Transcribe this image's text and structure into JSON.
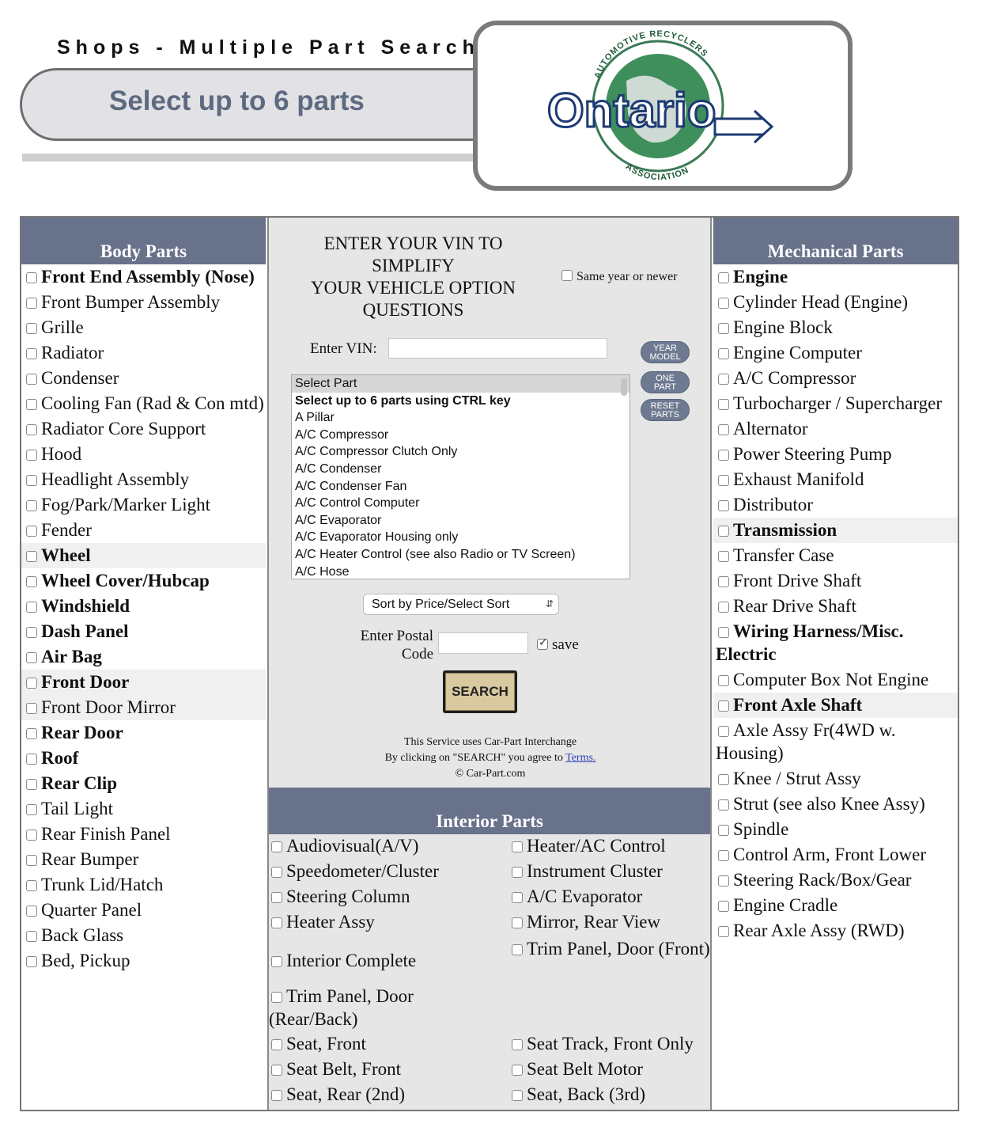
{
  "header": {
    "title": "Shops - Multiple Part Search",
    "banner": "Select up to 6 parts",
    "logo": {
      "top_arc": "AUTOMOTIVE RECYCLERS",
      "word": "Ontario",
      "bottom_arc": "ASSOCIATION"
    }
  },
  "body_parts": {
    "title": "Body Parts",
    "items": [
      {
        "label": "Front End Assembly (Nose)",
        "bold": true
      },
      {
        "label": "Front Bumper Assembly",
        "bold": false
      },
      {
        "label": "Grille",
        "bold": false
      },
      {
        "label": "Radiator",
        "bold": false
      },
      {
        "label": "Condenser",
        "bold": false
      },
      {
        "label": "Cooling Fan (Rad & Con mtd)",
        "bold": false
      },
      {
        "label": "Radiator Core Support",
        "bold": false
      },
      {
        "label": "Hood",
        "bold": false
      },
      {
        "label": "Headlight Assembly",
        "bold": false
      },
      {
        "label": "Fog/Park/Marker Light",
        "bold": false
      },
      {
        "label": "Fender",
        "bold": false
      },
      {
        "label": "Wheel",
        "bold": true
      },
      {
        "label": "Wheel Cover/Hubcap",
        "bold": true
      },
      {
        "label": "Windshield",
        "bold": true
      },
      {
        "label": "Dash Panel",
        "bold": true
      },
      {
        "label": "Air Bag",
        "bold": true
      },
      {
        "label": "Front Door",
        "bold": true
      },
      {
        "label": "Front Door Mirror",
        "bold": false
      },
      {
        "label": "Rear Door",
        "bold": true
      },
      {
        "label": "Roof",
        "bold": true
      },
      {
        "label": "Rear Clip",
        "bold": true
      },
      {
        "label": "Tail Light",
        "bold": false
      },
      {
        "label": "Rear Finish Panel",
        "bold": false
      },
      {
        "label": "Rear Bumper",
        "bold": false
      },
      {
        "label": "Trunk Lid/Hatch",
        "bold": false
      },
      {
        "label": "Quarter Panel",
        "bold": false
      },
      {
        "label": "Back Glass",
        "bold": false
      },
      {
        "label": "Bed, Pickup",
        "bold": false
      }
    ]
  },
  "mechanical_parts": {
    "title": "Mechanical Parts",
    "items": [
      {
        "label": "Engine",
        "bold": true
      },
      {
        "label": "Cylinder Head (Engine)",
        "bold": false
      },
      {
        "label": "Engine Block",
        "bold": false
      },
      {
        "label": "Engine Computer",
        "bold": false
      },
      {
        "label": "A/C Compressor",
        "bold": false
      },
      {
        "label": "Turbocharger / Supercharger",
        "bold": false
      },
      {
        "label": "Alternator",
        "bold": false
      },
      {
        "label": "Power Steering Pump",
        "bold": false
      },
      {
        "label": "Exhaust Manifold",
        "bold": false
      },
      {
        "label": "Distributor",
        "bold": false
      },
      {
        "label": "Transmission",
        "bold": true
      },
      {
        "label": "Transfer Case",
        "bold": false
      },
      {
        "label": "Front Drive Shaft",
        "bold": false
      },
      {
        "label": "Rear Drive Shaft",
        "bold": false
      },
      {
        "label": "Wiring Harness/Misc. Electric",
        "bold": true
      },
      {
        "label": "Computer Box Not Engine",
        "bold": false
      },
      {
        "label": "Front Axle Shaft",
        "bold": true
      },
      {
        "label": "Axle Assy Fr(4WD w. Housing)",
        "bold": false
      },
      {
        "label": "Knee / Strut Assy",
        "bold": false
      },
      {
        "label": "Strut (see also Knee Assy)",
        "bold": false
      },
      {
        "label": "Spindle",
        "bold": false
      },
      {
        "label": "Control Arm, Front Lower",
        "bold": false
      },
      {
        "label": "Steering Rack/Box/Gear",
        "bold": false
      },
      {
        "label": "Engine Cradle",
        "bold": false
      },
      {
        "label": "Rear Axle Assy (RWD)",
        "bold": false
      }
    ]
  },
  "vin": {
    "heading": [
      "ENTER YOUR VIN TO",
      "SIMPLIFY",
      "YOUR VEHICLE OPTION",
      "QUESTIONS"
    ],
    "same_year_label": "Same year or newer",
    "label": "Enter VIN:",
    "value": ""
  },
  "side_buttons": [
    {
      "line1": "YEAR",
      "line2": "MODEL"
    },
    {
      "line1": "ONE",
      "line2": "PART"
    },
    {
      "line1": "RESET",
      "line2": "PARTS"
    }
  ],
  "part_list": {
    "options": [
      {
        "label": "Select Part",
        "selected": true,
        "bold": false
      },
      {
        "label": "Select up to 6 parts using CTRL key",
        "selected": false,
        "bold": true
      },
      {
        "label": "A Pillar",
        "selected": false,
        "bold": false
      },
      {
        "label": "A/C Compressor",
        "selected": false,
        "bold": false
      },
      {
        "label": "A/C Compressor Clutch Only",
        "selected": false,
        "bold": false
      },
      {
        "label": "A/C Condenser",
        "selected": false,
        "bold": false
      },
      {
        "label": "A/C Condenser Fan",
        "selected": false,
        "bold": false
      },
      {
        "label": "A/C Control Computer",
        "selected": false,
        "bold": false
      },
      {
        "label": "A/C Evaporator",
        "selected": false,
        "bold": false
      },
      {
        "label": "A/C Evaporator Housing only",
        "selected": false,
        "bold": false
      },
      {
        "label": "A/C Heater Control (see also Radio or TV Screen)",
        "selected": false,
        "bold": false
      },
      {
        "label": "A/C Hose",
        "selected": false,
        "bold": false
      }
    ]
  },
  "sort": {
    "selected": "Sort by Price/Select Sort"
  },
  "postal": {
    "label_line1": "Enter Postal",
    "label_line2": "Code",
    "value": "",
    "save_label": "save",
    "save_checked": true
  },
  "search_button": "SEARCH",
  "service": {
    "line1": "This Service uses Car-Part Interchange",
    "line2_prefix": "By clicking on \"SEARCH\" you agree to ",
    "terms_link": "Terms.",
    "line3": "© Car-Part.com"
  },
  "interior_parts": {
    "title": "Interior Parts",
    "rows": [
      {
        "left": "Audiovisual(A/V)",
        "right": "Heater/AC Control"
      },
      {
        "left": "Speedometer/Cluster",
        "right": "Instrument Cluster"
      },
      {
        "left": "Steering Column",
        "right": "A/C Evaporator"
      },
      {
        "left": "Heater Assy",
        "right": "Mirror, Rear View"
      },
      {
        "left": "Interior Complete",
        "right": "Trim Panel, Door (Front)"
      },
      {
        "left": "Trim Panel, Door (Rear/Back)",
        "right": ""
      },
      {
        "left": "Seat, Front",
        "right": "Seat Track, Front Only"
      },
      {
        "left": "Seat Belt, Front",
        "right": "Seat Belt Motor"
      },
      {
        "left": "Seat, Rear (2nd)",
        "right": "Seat, Back (3rd)"
      }
    ]
  }
}
